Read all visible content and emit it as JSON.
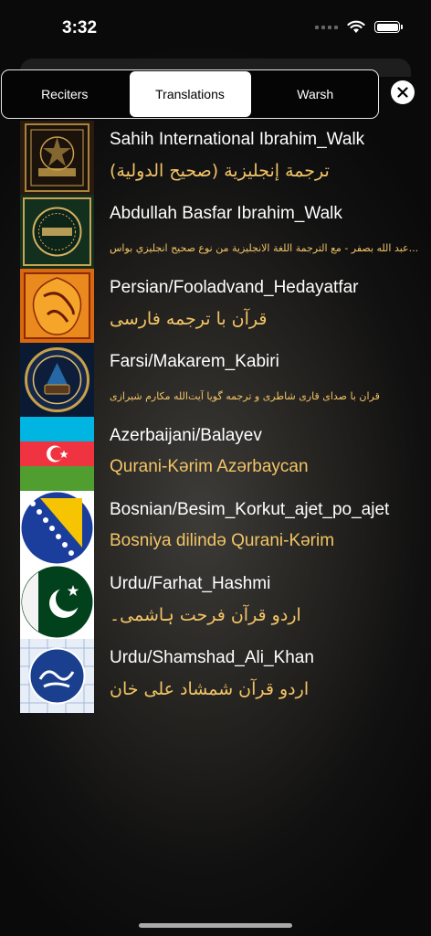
{
  "status": {
    "time": "3:32"
  },
  "tabs": [
    {
      "label": "Reciters",
      "active": false
    },
    {
      "label": "Translations",
      "active": true
    },
    {
      "label": "Warsh",
      "active": false
    }
  ],
  "items": [
    {
      "title": "Sahih International Ibrahim_Walk",
      "subtitle": "ترجمة إنجليزية (صحيح الدولية)",
      "thumb": "quran-book-cover"
    },
    {
      "title": "Abdullah Basfar Ibrahim_Walk",
      "subtitle": "عبد الله بصفر - مع الترجمة اللغة الانجليزية من نوع صحيح انجليزي بواس...",
      "thumb": "noble-quran-cover"
    },
    {
      "title": "Persian/Fooladvand_Hedayatfar",
      "subtitle": "قرآن با ترجمه فارسی",
      "thumb": "persian-calligraphy"
    },
    {
      "title": "Farsi/Makarem_Kabiri",
      "subtitle": "قران با صدای قاری شاطری و ترجمه گویا آیت‌الله مکارم شیرازی",
      "thumb": "illuminated-quran"
    },
    {
      "title": "Azerbaijani/Balayev",
      "subtitle": "Qurani-Kərim Azərbaycan",
      "thumb": "azerbaijan-flag"
    },
    {
      "title": "Bosnian/Besim_Korkut_ajet_po_ajet",
      "subtitle": "Bosniya dilində Qurani-Kərim",
      "thumb": "bosnia-flag"
    },
    {
      "title": "Urdu/Farhat_Hashmi",
      "subtitle": "اردو قرآن فرحت ہاشمی۔",
      "thumb": "pakistan-flag"
    },
    {
      "title": "Urdu/Shamshad_Ali_Khan",
      "subtitle": "اردو قرآن شمشاد علی خان",
      "thumb": "tarjuma-quran-calligraphy"
    }
  ],
  "colors": {
    "accent": "#f2c466",
    "background": "#1a1917"
  }
}
